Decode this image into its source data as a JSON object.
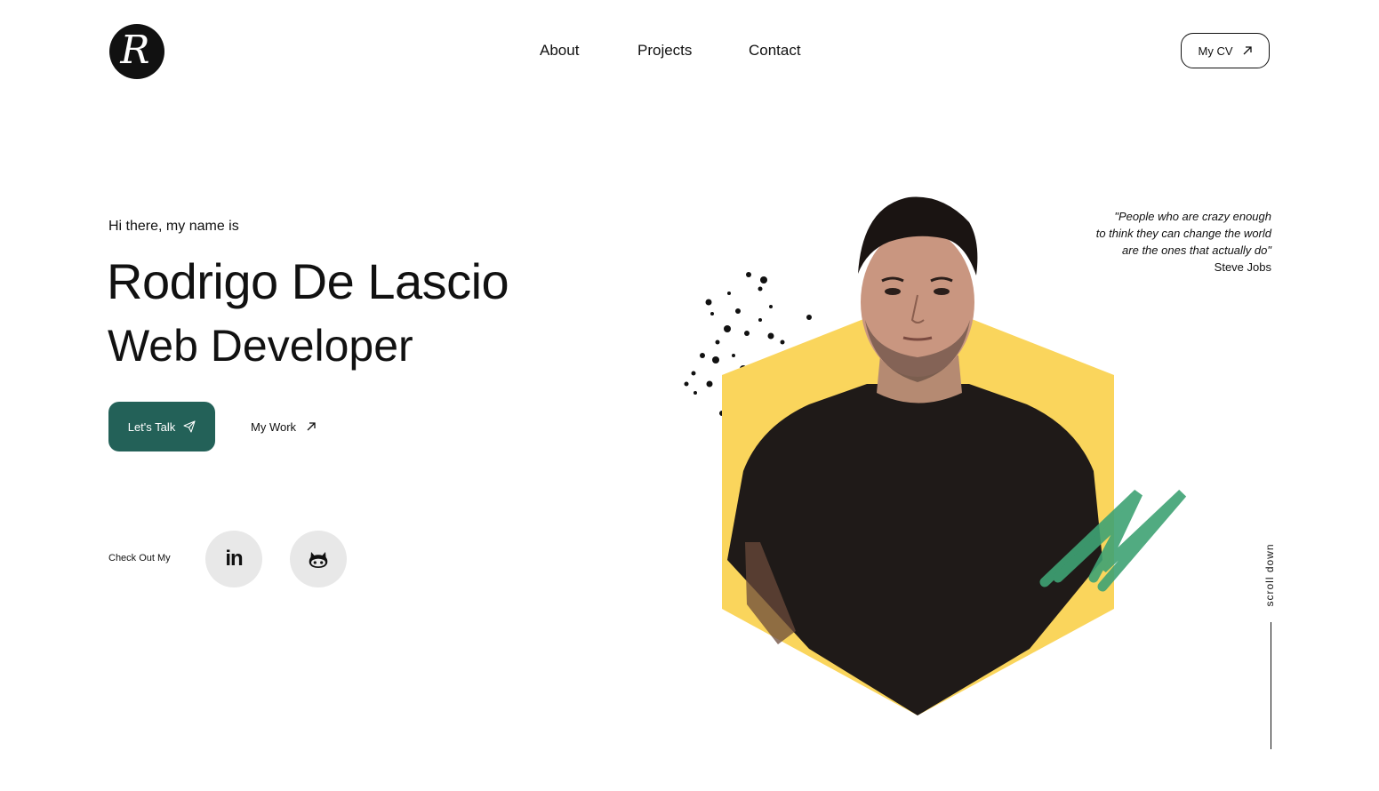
{
  "header": {
    "logo_letter": "R",
    "nav": [
      {
        "label": "About"
      },
      {
        "label": "Projects"
      },
      {
        "label": "Contact"
      }
    ],
    "cv_button": {
      "label": "My CV",
      "icon": "arrow-up-right-icon"
    }
  },
  "hero": {
    "greeting": "Hi there, my name is",
    "name": "Rodrigo De Lascio",
    "role": "Web Developer",
    "talk_button": {
      "label": "Let's Talk",
      "icon": "send-icon"
    },
    "work_link": {
      "label": "My Work",
      "icon": "arrow-up-right-icon"
    },
    "checkout_label": "Check Out My",
    "socials": [
      {
        "name": "linkedin",
        "text": "in"
      },
      {
        "name": "github",
        "icon": "github-icon"
      }
    ]
  },
  "quote": {
    "line1": "\"People who are crazy enough",
    "line2": "to think they can change the world",
    "line3": "are the ones that actually do\"",
    "author": "Steve Jobs"
  },
  "scroll": {
    "label": "scroll down"
  },
  "colors": {
    "accent": "#236158",
    "hexagon": "#FAD55C",
    "brush": "#3FA374",
    "social_bg": "#E8E8E8",
    "text": "#111111"
  }
}
